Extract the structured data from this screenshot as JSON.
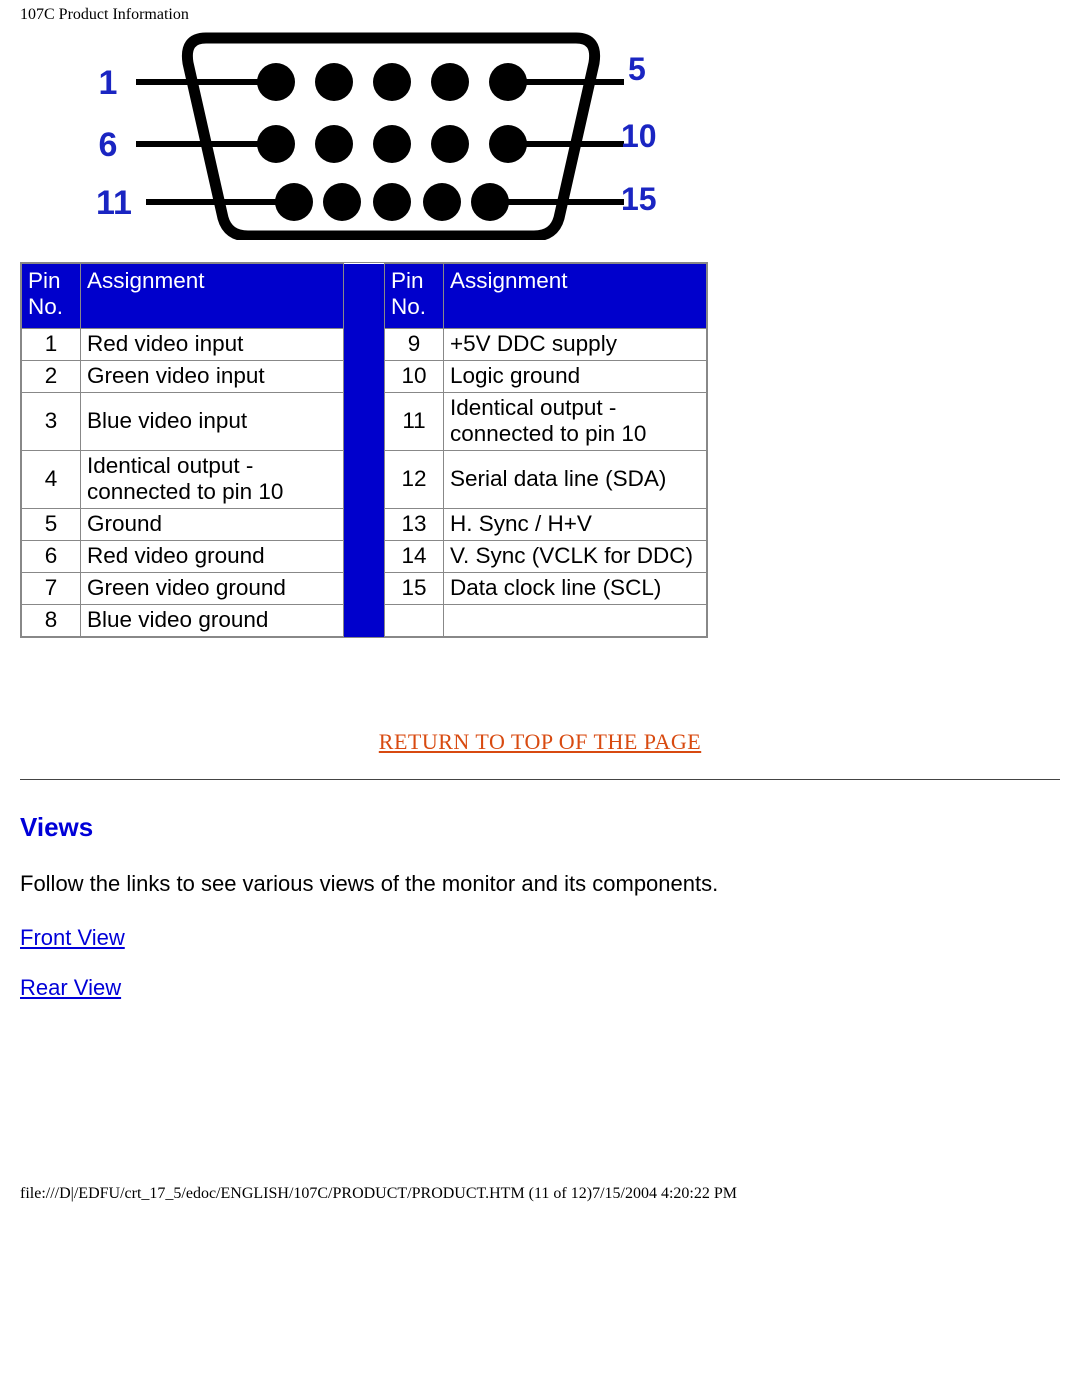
{
  "header_title": "107C Product Information",
  "connector_labels": {
    "row1_left": "1",
    "row1_right": "5",
    "row2_left": "6",
    "row2_right": "10",
    "row3_left": "11",
    "row3_right": "15"
  },
  "pin_table": {
    "header_pin": "Pin No.",
    "header_assign": "Assignment",
    "left_rows": [
      {
        "no": "1",
        "assign": "Red video input"
      },
      {
        "no": "2",
        "assign": "Green video input"
      },
      {
        "no": "3",
        "assign": "Blue video input"
      },
      {
        "no": "4",
        "assign": "Identical output - connected to pin 10"
      },
      {
        "no": "5",
        "assign": "Ground"
      },
      {
        "no": "6",
        "assign": "Red video ground"
      },
      {
        "no": "7",
        "assign": "Green video ground"
      },
      {
        "no": "8",
        "assign": "Blue video ground"
      }
    ],
    "right_rows": [
      {
        "no": "9",
        "assign": "+5V DDC supply"
      },
      {
        "no": "10",
        "assign": "Logic ground"
      },
      {
        "no": "11",
        "assign": "Identical output - connected to pin 10"
      },
      {
        "no": "12",
        "assign": "Serial data line (SDA)"
      },
      {
        "no": "13",
        "assign": "H. Sync / H+V"
      },
      {
        "no": "14",
        "assign": "V. Sync (VCLK for DDC)"
      },
      {
        "no": "15",
        "assign": "Data clock line (SCL)"
      },
      {
        "no": "",
        "assign": ""
      }
    ]
  },
  "return_link": "RETURN TO TOP OF THE PAGE",
  "views_heading": "Views",
  "views_body": "Follow the links to see various views of the monitor and its components.",
  "front_view_link": "Front View",
  "rear_view_link": "Rear View",
  "footer_path": "file:///D|/EDFU/crt_17_5/edoc/ENGLISH/107C/PRODUCT/PRODUCT.HTM (11 of 12)7/15/2004 4:20:22 PM"
}
